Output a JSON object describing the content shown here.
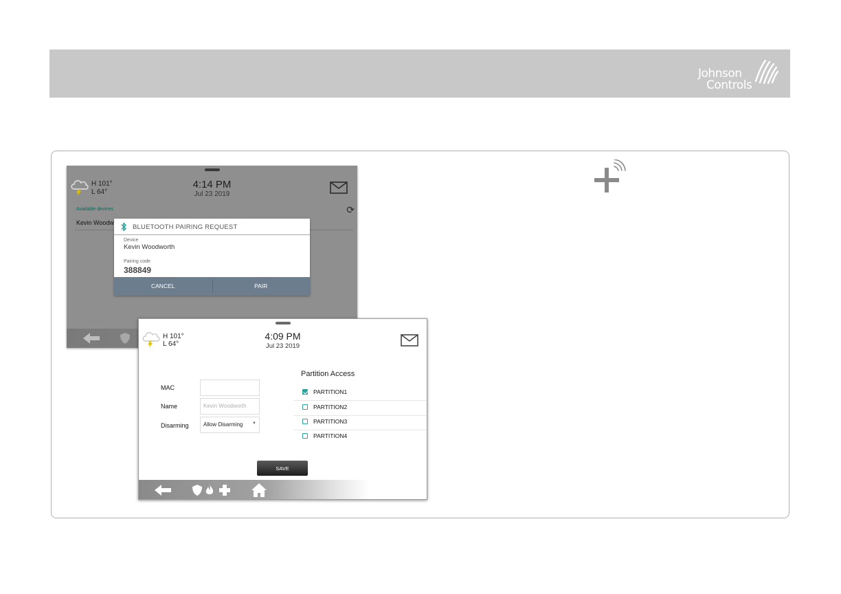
{
  "brand": {
    "line1": "Johnson",
    "line2": "Controls",
    "header_color": "#c8c8c8"
  },
  "screen1": {
    "weather": {
      "icon": "cloud-lightning-icon",
      "high": "H 101°",
      "low": "L 64°"
    },
    "time": "4:14 PM",
    "date": "Jul 23 2019",
    "available_label": "Available devices",
    "device_row": "Kevin Woodworth",
    "dialog": {
      "title": "BLUETOOTH PAIRING REQUEST",
      "device_label": "Device",
      "device_value": "Kevin Woodworth",
      "code_label": "Pairing code",
      "code_value": "388849",
      "cancel": "CANCEL",
      "pair": "PAIR"
    }
  },
  "screen2": {
    "weather": {
      "icon": "cloud-lightning-icon",
      "high": "H 101°",
      "low": "L 64°"
    },
    "time": "4:09 PM",
    "date": "Jul 23 2019",
    "form": {
      "mac_label": "MAC",
      "mac_value": "",
      "name_label": "Name",
      "name_placeholder": "Kevin Woodworth",
      "disarm_label": "Disarming",
      "disarm_value": "Allow Disarming"
    },
    "partition_title": "Partition Access",
    "partitions": [
      {
        "label": "PARTITION1",
        "checked": true
      },
      {
        "label": "PARTITION2",
        "checked": false
      },
      {
        "label": "PARTITION3",
        "checked": false
      },
      {
        "label": "PARTITION4",
        "checked": false
      }
    ],
    "save": "SAVE"
  },
  "accent_color": "#2aa39a"
}
